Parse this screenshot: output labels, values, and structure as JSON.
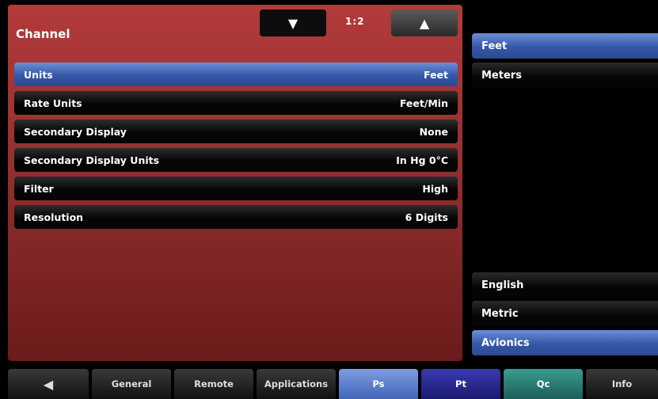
{
  "header": {
    "title": "Channel",
    "page_indicator": "1:2",
    "down_arrow": "▼",
    "up_arrow": "▲"
  },
  "settings": [
    {
      "label": "Units",
      "value": "Feet",
      "selected": true
    },
    {
      "label": "Rate Units",
      "value": "Feet/Min"
    },
    {
      "label": "Secondary Display",
      "value": "None"
    },
    {
      "label": "Secondary Display Units",
      "value": "In Hg 0°C"
    },
    {
      "label": "Filter",
      "value": "High"
    },
    {
      "label": "Resolution",
      "value": "6 Digits"
    }
  ],
  "options": {
    "units": [
      "Feet",
      "Meters"
    ],
    "systems": [
      "English",
      "Metric",
      "Avionics"
    ]
  },
  "tabs": {
    "back_icon": "◀",
    "items": [
      "General",
      "Remote",
      "Applications",
      "Ps",
      "Pt",
      "Qc",
      "Info"
    ]
  },
  "colors": {
    "panel": "#963131",
    "selected": "#3457a8",
    "ps_tab": "#4466b8",
    "pt_tab": "#1a1a70",
    "qc_tab": "#1d5e58"
  }
}
